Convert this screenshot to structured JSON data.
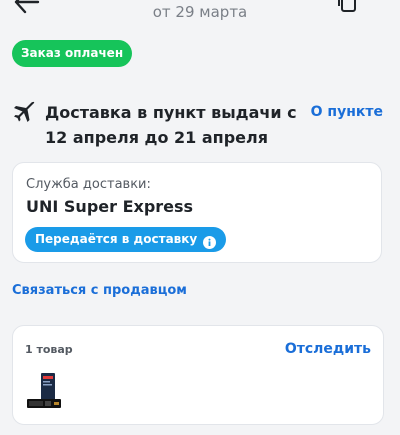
{
  "header": {
    "date": "от 29 марта",
    "back_icon": "arrow-left-icon",
    "copy_icon": "copy-icon"
  },
  "order": {
    "status": "Заказ оплачен",
    "status_color": "#16c45a"
  },
  "delivery": {
    "icon": "airplane-icon",
    "title": "Доставка в пункт выдачи с 12 апреля до 21 апреля",
    "pickup_link": "О пункте"
  },
  "service": {
    "label": "Служба доставки:",
    "name": "UNI Super Express",
    "status_badge": "Передаётся в доставку",
    "status_badge_color": "#1a9be8"
  },
  "contact_seller": "Связаться с продавцом",
  "items": {
    "count_label": "1 товар",
    "track_link": "Отследить",
    "product_icon": "ssd-product-image"
  },
  "accent_color": "#1a6ed8"
}
